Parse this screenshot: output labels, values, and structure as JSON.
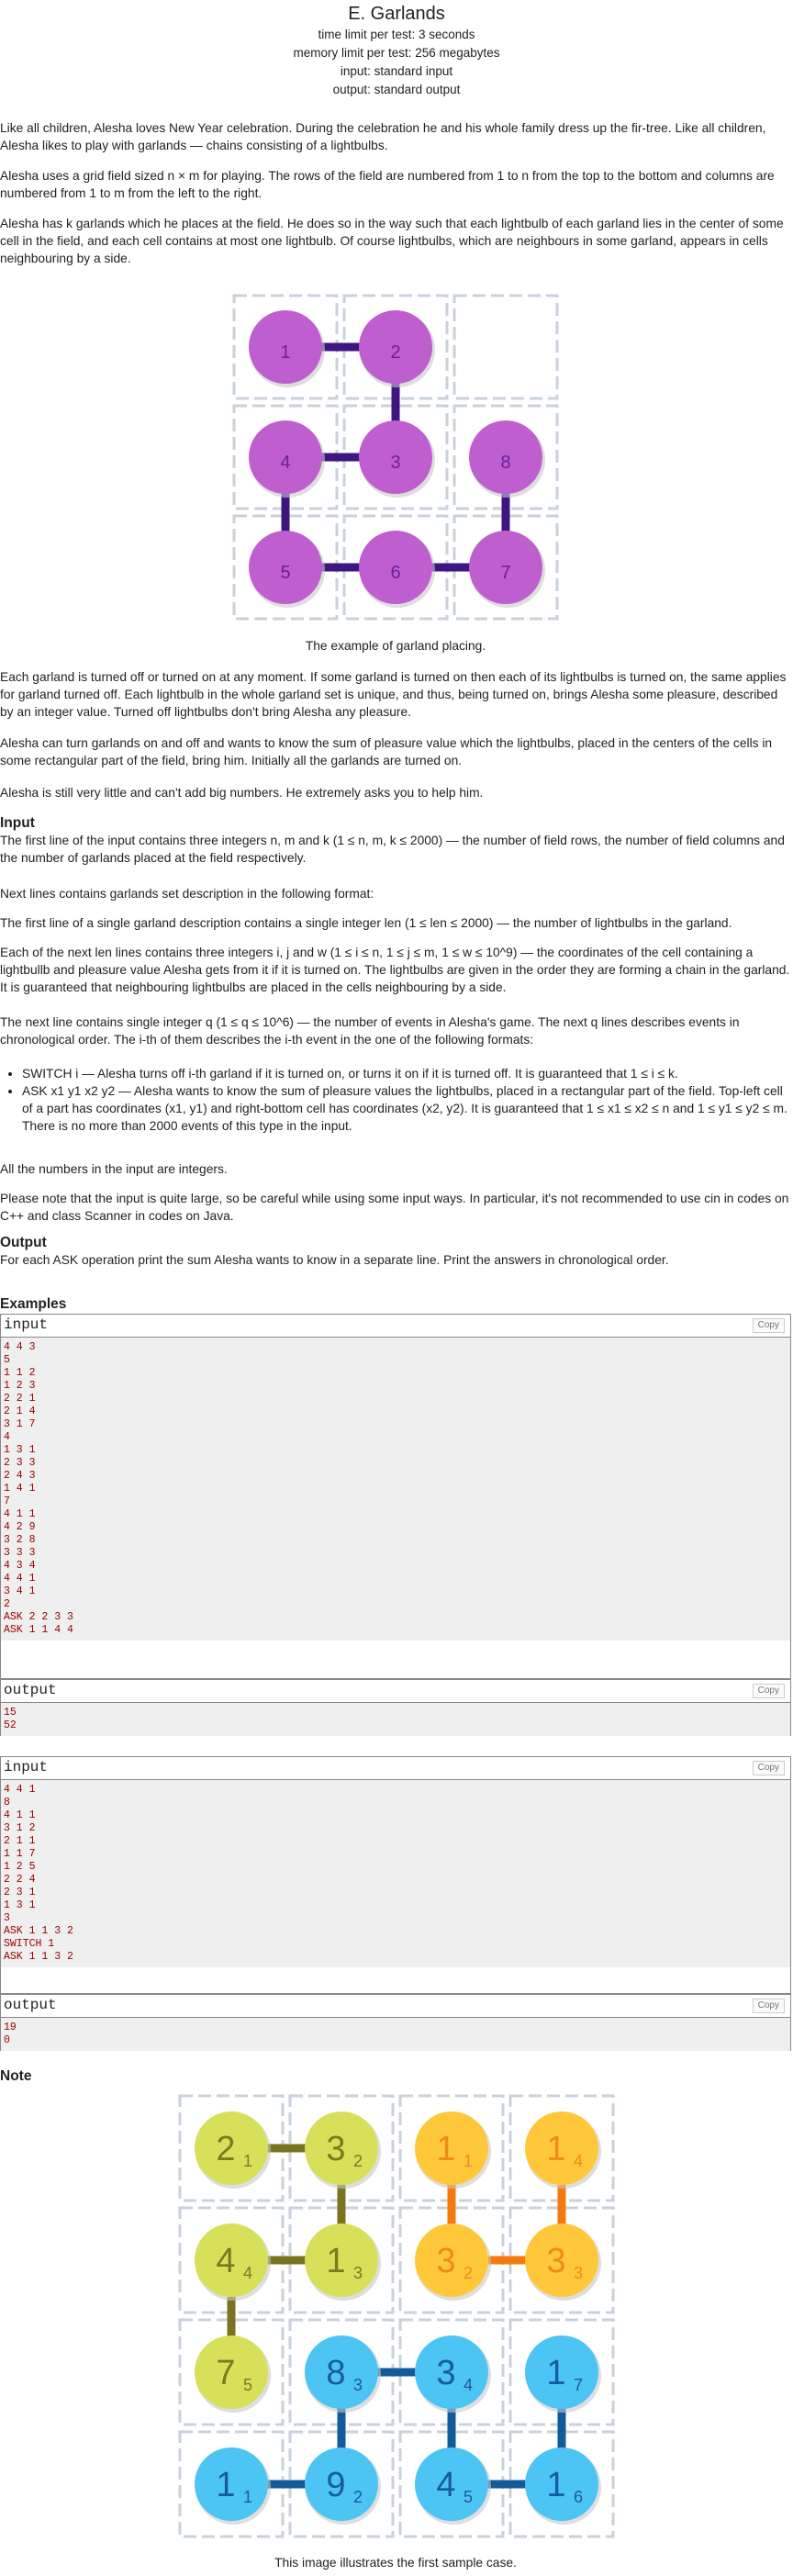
{
  "header": {
    "title": "E. Garlands",
    "time_limit": "time limit per test: 3 seconds",
    "memory_limit": "memory limit per test: 256 megabytes",
    "input": "input: standard input",
    "output": "output: standard output"
  },
  "statement": {
    "p1": "Like all children, Alesha loves New Year celebration. During the celebration he and his whole family dress up the fir-tree. Like all children, Alesha likes to play with garlands — chains consisting of a lightbulbs.",
    "p2": "Alesha uses a grid field sized n × m for playing. The rows of the field are numbered from 1 to n from the top to the bottom and columns are numbered from 1 to m from the left to the right.",
    "p3": "Alesha has k garlands which he places at the field. He does so in the way such that each lightbulb of each garland lies in the center of some cell in the field, and each cell contains at most one lightbulb. Of course lightbulbs, which are neighbours in some garland, appears in cells neighbouring by a side.",
    "fig1_caption": "The example of garland placing.",
    "p4": "Each garland is turned off or turned on at any moment. If some garland is turned on then each of its lightbulbs is turned on, the same applies for garland turned off. Each lightbulb in the whole garland set is unique, and thus, being turned on, brings Alesha some pleasure, described by an integer value. Turned off lightbulbs don't bring Alesha any pleasure.",
    "p5": "Alesha can turn garlands on and off and wants to know the sum of pleasure value which the lightbulbs, placed in the centers of the cells in some rectangular part of the field, bring him. Initially all the garlands are turned on.",
    "p6": "Alesha is still very little and can't add big numbers. He extremely asks you to help him."
  },
  "input_section": {
    "heading": "Input",
    "p1": "The first line of the input contains three integers n, m and k (1 ≤ n, m, k ≤ 2000) — the number of field rows, the number of field columns and the number of garlands placed at the field respectively.",
    "p2": "Next lines contains garlands set description in the following format:",
    "p3": "The first line of a single garland description contains a single integer len (1 ≤ len ≤ 2000) — the number of lightbulbs in the garland.",
    "p4": "Each of the next len lines contains three integers i, j and w (1 ≤ i ≤ n, 1 ≤ j ≤ m, 1 ≤ w ≤ 10^9) — the coordinates of the cell containing a lightbullb and pleasure value Alesha gets from it if it is turned on. The lightbulbs are given in the order they are forming a chain in the garland. It is guaranteed that neighbouring lightbulbs are placed in the cells neighbouring by a side.",
    "p5": "The next line contains single integer q (1 ≤ q ≤ 10^6) — the number of events in Alesha's game. The next q lines describes events in chronological order. The i-th of them describes the i-th event in the one of the following formats:",
    "li1": "SWITCH i — Alesha turns off i-th garland if it is turned on, or turns it on if it is turned off. It is guaranteed that 1 ≤ i ≤ k.",
    "li2": "ASK x1 y1 x2 y2 — Alesha wants to know the sum of pleasure values the lightbulbs, placed in a rectangular part of the field. Top-left cell of a part has coordinates (x1, y1) and right-bottom cell has coordinates (x2, y2). It is guaranteed that 1 ≤ x1 ≤ x2 ≤ n and 1 ≤ y1 ≤ y2 ≤ m. There is no more than 2000 events of this type in the input.",
    "p6": "All the numbers in the input are integers.",
    "p7": "Please note that the input is quite large, so be careful while using some input ways. In particular, it's not recommended to use cin in codes on C++ and class Scanner in codes on Java."
  },
  "output_section": {
    "heading": "Output",
    "p1": "For each ASK operation print the sum Alesha wants to know in a separate line. Print the answers in chronological order."
  },
  "examples": {
    "heading": "Examples",
    "input_label": "input",
    "output_label": "output",
    "copy_label": "Copy",
    "ex1_input": "4 4 3\n5\n1 1 2\n1 2 3\n2 2 1\n2 1 4\n3 1 7\n4\n1 3 1\n2 3 3\n2 4 3\n1 4 1\n7\n4 1 1\n4 2 9\n3 2 8\n3 3 3\n4 3 4\n4 4 1\n3 4 1\n2\nASK 2 2 3 3\nASK 1 1 4 4",
    "ex1_output": "15\n52",
    "ex2_input": "4 4 1\n8\n4 1 1\n3 1 2\n2 1 1\n1 1 7\n1 2 5\n2 2 4\n2 3 1\n1 3 1\n3\nASK 1 1 3 2\nSWITCH 1\nASK 1 1 3 2",
    "ex2_output": "19\n0"
  },
  "note": {
    "heading": "Note",
    "caption": "This image illustrates the first sample case."
  },
  "figure1": {
    "bulbs": [
      {
        "label": "1",
        "row": 0,
        "col": 0
      },
      {
        "label": "2",
        "row": 0,
        "col": 1
      },
      {
        "label": "4",
        "row": 1,
        "col": 0
      },
      {
        "label": "3",
        "row": 1,
        "col": 1
      },
      {
        "label": "8",
        "row": 1,
        "col": 2
      },
      {
        "label": "5",
        "row": 2,
        "col": 0
      },
      {
        "label": "6",
        "row": 2,
        "col": 1
      },
      {
        "label": "7",
        "row": 2,
        "col": 2
      }
    ],
    "links": [
      [
        0,
        1
      ],
      [
        1,
        3
      ],
      [
        3,
        2
      ],
      [
        2,
        5
      ],
      [
        5,
        6
      ],
      [
        6,
        7
      ],
      [
        7,
        4
      ]
    ],
    "bulb_color": "#bf5fcf",
    "link_color": "#3f1580"
  },
  "figure2": {
    "bulbs": [
      {
        "main": "2",
        "sub": "1",
        "row": 0,
        "col": 0,
        "g": 0
      },
      {
        "main": "3",
        "sub": "2",
        "row": 0,
        "col": 1,
        "g": 0
      },
      {
        "main": "4",
        "sub": "4",
        "row": 1,
        "col": 0,
        "g": 0
      },
      {
        "main": "1",
        "sub": "3",
        "row": 1,
        "col": 1,
        "g": 0
      },
      {
        "main": "7",
        "sub": "5",
        "row": 2,
        "col": 0,
        "g": 0
      },
      {
        "main": "1",
        "sub": "1",
        "row": 0,
        "col": 2,
        "g": 1
      },
      {
        "main": "1",
        "sub": "4",
        "row": 0,
        "col": 3,
        "g": 1
      },
      {
        "main": "3",
        "sub": "2",
        "row": 1,
        "col": 2,
        "g": 1
      },
      {
        "main": "3",
        "sub": "3",
        "row": 1,
        "col": 3,
        "g": 1
      },
      {
        "main": "8",
        "sub": "3",
        "row": 2,
        "col": 1,
        "g": 2
      },
      {
        "main": "3",
        "sub": "4",
        "row": 2,
        "col": 2,
        "g": 2
      },
      {
        "main": "1",
        "sub": "7",
        "row": 2,
        "col": 3,
        "g": 2
      },
      {
        "main": "1",
        "sub": "1",
        "row": 3,
        "col": 0,
        "g": 2
      },
      {
        "main": "9",
        "sub": "2",
        "row": 3,
        "col": 1,
        "g": 2
      },
      {
        "main": "4",
        "sub": "5",
        "row": 3,
        "col": 2,
        "g": 2
      },
      {
        "main": "1",
        "sub": "6",
        "row": 3,
        "col": 3,
        "g": 2
      }
    ],
    "links": [
      [
        0,
        1
      ],
      [
        1,
        3
      ],
      [
        3,
        2
      ],
      [
        2,
        4
      ],
      [
        5,
        7
      ],
      [
        7,
        8
      ],
      [
        8,
        6
      ],
      [
        12,
        13
      ],
      [
        13,
        9
      ],
      [
        9,
        10
      ],
      [
        10,
        14
      ],
      [
        14,
        15
      ],
      [
        15,
        11
      ]
    ],
    "garland_colors": [
      {
        "bulb": "#d8e05a",
        "text": "#7a7a20",
        "link": "#7a7420"
      },
      {
        "bulb": "#ffc83a",
        "text": "#f08a1a",
        "link": "#f47a10"
      },
      {
        "bulb": "#4cc4f4",
        "text": "#1a5aa0",
        "link": "#135a9a"
      }
    ]
  }
}
